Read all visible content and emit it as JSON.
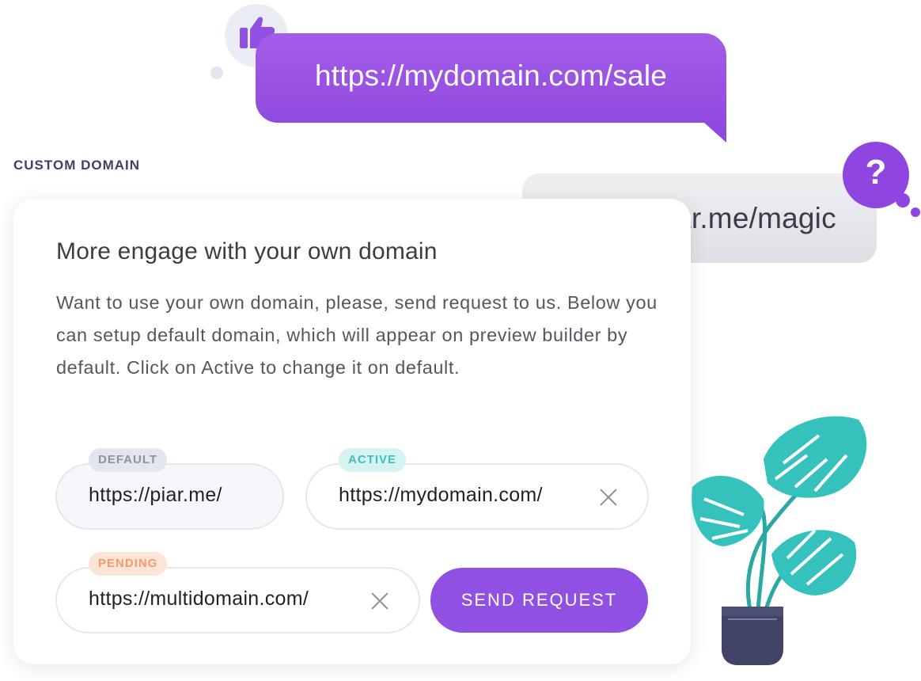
{
  "bubbles": {
    "primary_url": "https://mydomain.com/sale",
    "secondary_url": "https://piar.me/magic",
    "thumb_icon": "thumbs-up-icon",
    "question_icon": "question-mark-icon",
    "question_glyph": "?"
  },
  "section": {
    "title": "CUSTOM DOMAIN"
  },
  "card": {
    "heading": "More engage with your own domain",
    "description": "Want to use your own domain, please, send request to us. Below you can setup default domain, which will appear on preview builder by default. Click on Active to change it on default."
  },
  "domains": {
    "default": {
      "badge": "DEFAULT",
      "value": "https://piar.me/"
    },
    "active": {
      "badge": "ACTIVE",
      "value": "https://mydomain.com/"
    },
    "pending": {
      "badge": "PENDING",
      "value": "https://multidomain.com/"
    }
  },
  "actions": {
    "send_label": "SEND REQUEST"
  },
  "colors": {
    "accent": "#9050e2",
    "active": "#3ebfb7",
    "pending": "#f49b6c",
    "default": "#8e929d",
    "plant": "#35c2bd",
    "pot": "#414366"
  }
}
